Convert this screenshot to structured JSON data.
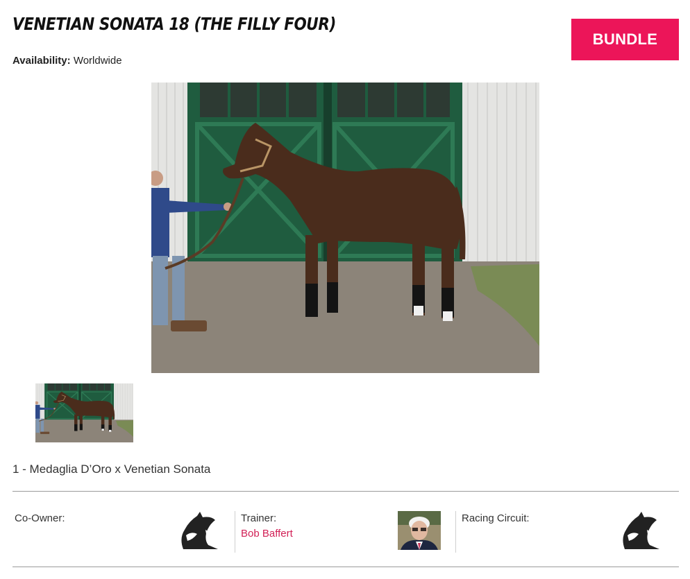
{
  "listing": {
    "title": "VENETIAN SONATA 18 (THE FILLY FOUR)",
    "availability_label": "Availability:",
    "availability_value": "Worldwide",
    "bundle_label": "BUNDLE",
    "pedigree": "1 - Medaglia D’Oro x Venetian Sonata"
  },
  "gallery": {
    "main_image": "bay-filly-photo",
    "thumbnails": [
      "bay-filly-photo"
    ]
  },
  "details": {
    "co_owner_label": "Co-Owner:",
    "co_owner_icon": "horse-head-logo-icon",
    "trainer_label": "Trainer:",
    "trainer_name": "Bob Baffert",
    "trainer_photo": "trainer-portrait",
    "racing_circuit_label": "Racing Circuit:",
    "racing_circuit_icon": "horse-head-logo-icon"
  },
  "colors": {
    "accent": "#ec1559",
    "link": "#d11f55",
    "divider": "#9a9a9a"
  }
}
